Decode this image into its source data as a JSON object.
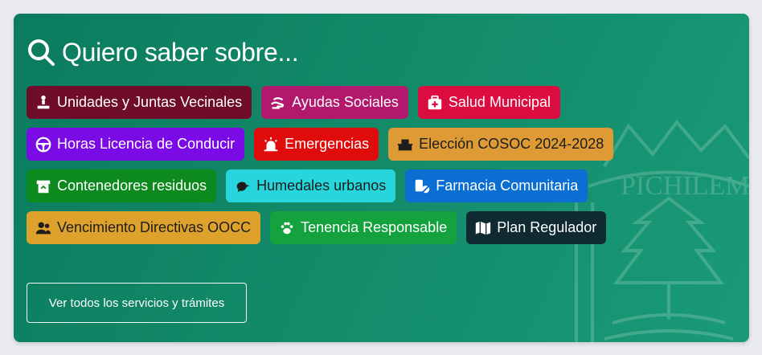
{
  "header": {
    "title": "Quiero saber sobre...",
    "icon": "search-icon"
  },
  "chips": [
    [
      {
        "label": "Unidades y Juntas Vecinales",
        "icon": "neighborhood-icon",
        "color": "#6e0c2a",
        "text": "light"
      },
      {
        "label": "Ayudas Sociales",
        "icon": "helping-hand-icon",
        "color": "#b2186c",
        "text": "light"
      },
      {
        "label": "Salud Municipal",
        "icon": "first-aid-kit-icon",
        "color": "#dc0c40",
        "text": "light"
      }
    ],
    [
      {
        "label": "Horas Licencia de Conducir",
        "icon": "steering-wheel-icon",
        "color": "#7a0ae6",
        "text": "light"
      },
      {
        "label": "Emergencias",
        "icon": "siren-icon",
        "color": "#e00c0c",
        "text": "light"
      },
      {
        "label": "Elección COSOC 2024-2028",
        "icon": "ballot-box-icon",
        "color": "#de9b35",
        "text": "dark"
      }
    ],
    [
      {
        "label": "Contenedores residuos",
        "icon": "recycle-bin-icon",
        "color": "#0c8a1e",
        "text": "light"
      },
      {
        "label": "Humedales urbanos",
        "icon": "bird-icon",
        "color": "#27d6dc",
        "text": "dark"
      },
      {
        "label": "Farmacia Comunitaria",
        "icon": "pills-icon",
        "color": "#0a6ed2",
        "text": "light"
      }
    ],
    [
      {
        "label": "Vencimiento Directivas OOCC",
        "icon": "users-icon",
        "color": "#dea22c",
        "text": "dark"
      },
      {
        "label": "Tenencia Responsable",
        "icon": "paw-icon",
        "color": "#14a23e",
        "text": "light"
      },
      {
        "label": "Plan Regulador",
        "icon": "map-icon",
        "color": "#0f2a31",
        "text": "light"
      }
    ]
  ],
  "footer": {
    "all_services_label": "Ver todos los servicios y trámites"
  },
  "watermark": {
    "text": "PICHILEMU",
    "icon": "municipal-crest-icon"
  },
  "colors": {
    "card_background": "#128a68",
    "page_background": "#e9ebee"
  }
}
